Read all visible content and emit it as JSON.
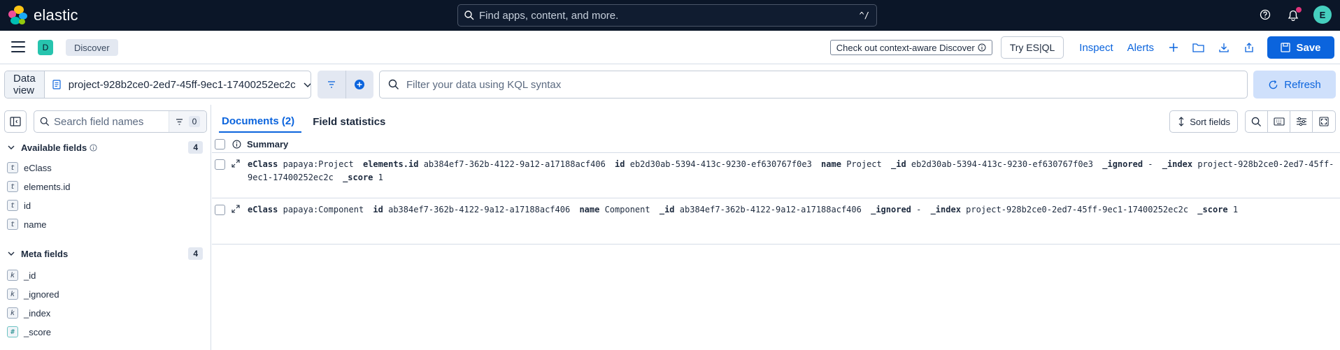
{
  "topbar": {
    "logo_text": "elastic",
    "search_placeholder": "Find apps, content, and more.",
    "search_shortcut": "^/",
    "avatar_initial": "E",
    "icons": [
      "help-icon",
      "notifications-icon"
    ]
  },
  "appbar": {
    "app_badge": "D",
    "breadcrumb": "Discover",
    "context_aware": "Check out context-aware Discover",
    "try_esql": "Try ES|QL",
    "inspect": "Inspect",
    "alerts": "Alerts",
    "save": "Save"
  },
  "querybar": {
    "data_view_label": "Data view",
    "data_view_value": "project-928b2ce0-2ed7-45ff-9ec1-17400252ec2c",
    "kql_placeholder": "Filter your data using KQL syntax",
    "refresh": "Refresh"
  },
  "sidebar": {
    "search_placeholder": "Search field names",
    "filter_count": "0",
    "available": {
      "title": "Available fields",
      "count": "4",
      "fields": [
        {
          "type": "t",
          "name": "eClass"
        },
        {
          "type": "t",
          "name": "elements.id"
        },
        {
          "type": "t",
          "name": "id"
        },
        {
          "type": "t",
          "name": "name"
        }
      ]
    },
    "meta": {
      "title": "Meta fields",
      "count": "4",
      "fields": [
        {
          "type": "k",
          "name": "_id"
        },
        {
          "type": "k",
          "name": "_ignored"
        },
        {
          "type": "k",
          "name": "_index"
        },
        {
          "type": "#",
          "name": "_score"
        }
      ]
    }
  },
  "main": {
    "tab_documents": "Documents (2)",
    "tab_field_stats": "Field statistics",
    "sort_fields": "Sort fields",
    "summary_header": "Summary",
    "rows": [
      [
        {
          "k": "eClass",
          "v": "papaya:Project"
        },
        {
          "k": "elements.id",
          "v": "ab384ef7-362b-4122-9a12-a17188acf406"
        },
        {
          "k": "id",
          "v": "eb2d30ab-5394-413c-9230-ef630767f0e3"
        },
        {
          "k": "name",
          "v": "Project"
        },
        {
          "k": "_id",
          "v": "eb2d30ab-5394-413c-9230-ef630767f0e3"
        },
        {
          "k": "_ignored",
          "v": " - "
        },
        {
          "k": "_index",
          "v": "project-928b2ce0-2ed7-45ff-9ec1-17400252ec2c"
        },
        {
          "k": "_score",
          "v": "1"
        }
      ],
      [
        {
          "k": "eClass",
          "v": "papaya:Component"
        },
        {
          "k": "id",
          "v": "ab384ef7-362b-4122-9a12-a17188acf406"
        },
        {
          "k": "name",
          "v": "Component"
        },
        {
          "k": "_id",
          "v": "ab384ef7-362b-4122-9a12-a17188acf406"
        },
        {
          "k": "_ignored",
          "v": " - "
        },
        {
          "k": "_index",
          "v": "project-928b2ce0-2ed7-45ff-9ec1-17400252ec2c"
        },
        {
          "k": "_score",
          "v": "1"
        }
      ]
    ]
  },
  "colors": {
    "topbar_bg": "#0b1628",
    "primary": "#0b64dd",
    "app_badge": "#27c4ae",
    "avatar": "#45cfbe"
  }
}
